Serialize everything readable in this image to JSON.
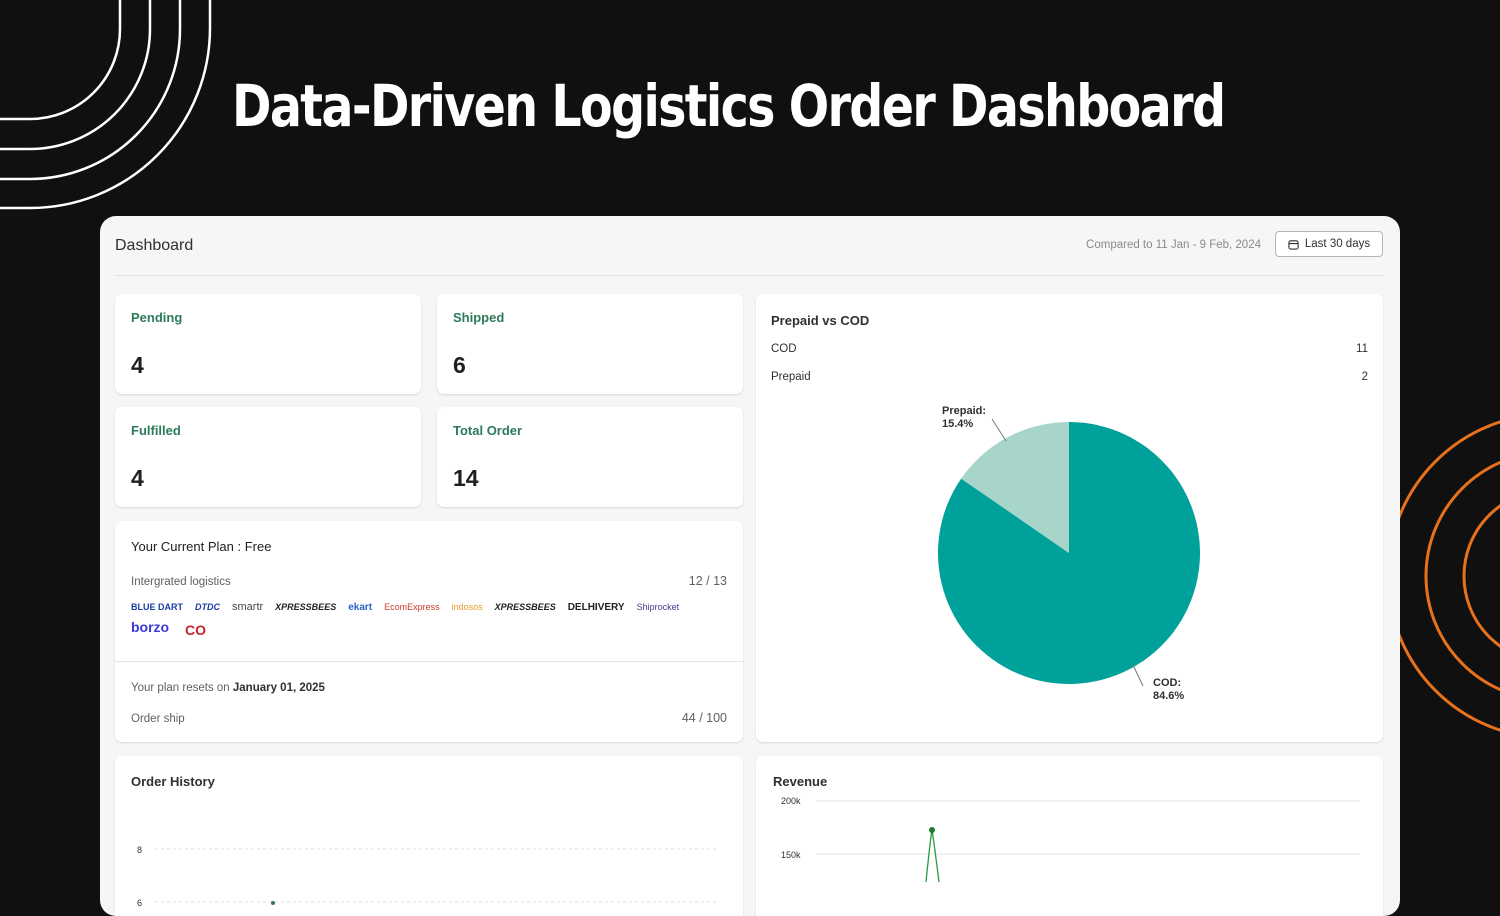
{
  "headline": "Data-Driven Logistics Order Dashboard",
  "colors": {
    "accent_green": "#2c7a59",
    "cod_color": "#00a19a",
    "prepaid_color": "#a8d5c9",
    "deco_orange": "#e8721c"
  },
  "header": {
    "title": "Dashboard",
    "compared_to": "Compared to 11 Jan - 9 Feb, 2024",
    "range_button": "Last 30 days",
    "range_icon": "calendar-icon"
  },
  "stats": [
    {
      "label": "Pending",
      "value": "4"
    },
    {
      "label": "Shipped",
      "value": "6"
    },
    {
      "label": "Fulfilled",
      "value": "4"
    },
    {
      "label": "Total Order",
      "value": "14"
    }
  ],
  "plan": {
    "title": "Your Current Plan : Free",
    "integrated_label": "Intergrated logistics",
    "integrated_count": "12 / 13",
    "logos": [
      "BLUE DART",
      "DTDC",
      "smartr",
      "XPRESSBEES",
      "ekart",
      "EcomExpress",
      "indosos",
      "XPRESSBEES",
      "DELHIVERY",
      "Shiprocket",
      "borzo",
      "CO"
    ],
    "reset_prefix": "Your plan resets on",
    "reset_date": "January 01, 2025",
    "order_ship_label": "Order ship",
    "order_ship_count": "44 / 100"
  },
  "prepaid_cod": {
    "title": "Prepaid vs COD",
    "legend": [
      {
        "label": "COD",
        "value": "11"
      },
      {
        "label": "Prepaid",
        "value": "2"
      }
    ],
    "slice_labels": [
      {
        "name": "Prepaid:",
        "pct": "15.4%"
      },
      {
        "name": "COD:",
        "pct": "84.6%"
      }
    ]
  },
  "order_history": {
    "title": "Order History",
    "y_ticks": [
      "8",
      "6"
    ]
  },
  "revenue": {
    "title": "Revenue",
    "y_ticks": [
      "200k",
      "150k"
    ]
  },
  "chart_data": {
    "type": "pie",
    "title": "Prepaid vs COD",
    "categories": [
      "Prepaid",
      "COD"
    ],
    "values": [
      2,
      11
    ],
    "percent": [
      15.4,
      84.6
    ]
  }
}
